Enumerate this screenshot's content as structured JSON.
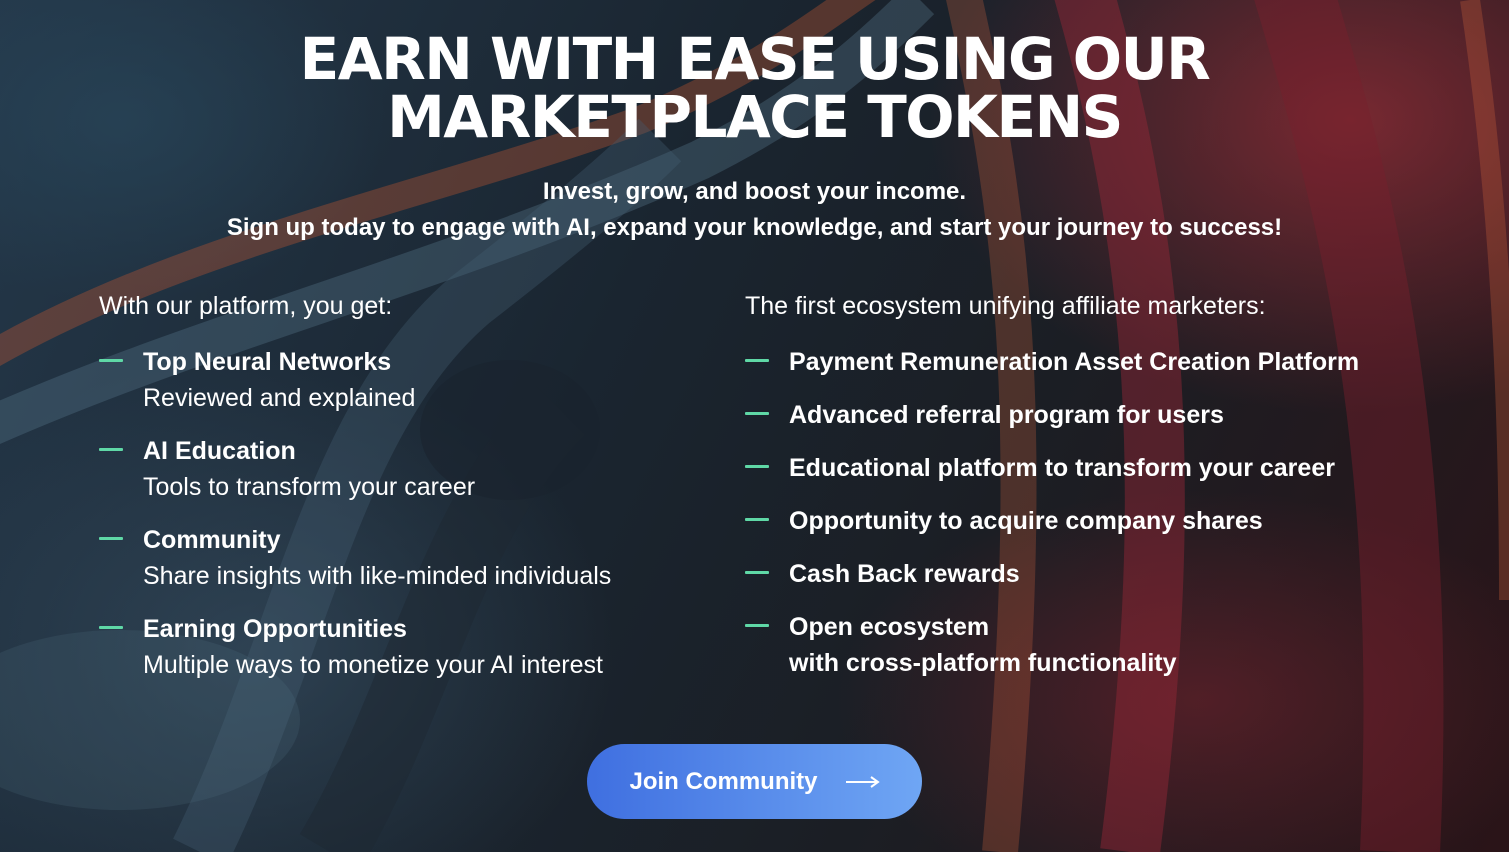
{
  "hero": {
    "title_line1": "EARN WITH EASE USING OUR",
    "title_line2": "MARKETPLACE TOKENS",
    "subtitle_line1": "Invest, grow, and boost your income.",
    "subtitle_line2": "Sign up today to engage with AI, expand your knowledge, and start your journey to success!"
  },
  "platform": {
    "heading": "With our platform, you get:",
    "features": [
      {
        "title": "Top Neural Networks",
        "description": "Reviewed and explained"
      },
      {
        "title": "AI Education",
        "description": "Tools to transform your career"
      },
      {
        "title": "Community",
        "description": "Share insights with like-minded individuals"
      },
      {
        "title": "Earning Opportunities",
        "description": "Multiple ways to monetize your AI interest"
      }
    ]
  },
  "ecosystem": {
    "heading": "The first ecosystem unifying affiliate marketers:",
    "items": [
      {
        "title": "Payment Remuneration Asset Creation Platform"
      },
      {
        "title": "Advanced referral program for users"
      },
      {
        "title": "Educational platform to transform your career"
      },
      {
        "title": "Opportunity to acquire company shares"
      },
      {
        "title": "Cash Back rewards"
      },
      {
        "title": "Open ecosystem",
        "title_line2": "with cross-platform functionality"
      }
    ]
  },
  "cta": {
    "label": "Join Community",
    "icon": "arrow-right-icon"
  },
  "colors": {
    "accent_dash": "#5fd8a6",
    "button_gradient_start": "#3f6fe0",
    "button_gradient_end": "#6fa6f4",
    "text": "#ffffff"
  }
}
